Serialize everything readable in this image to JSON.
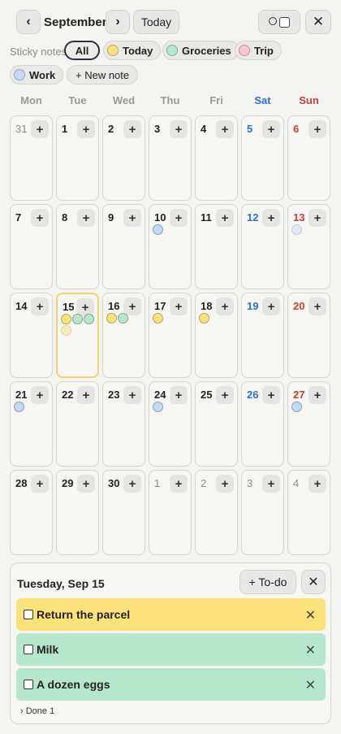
{
  "colors": {
    "today": "#fbe27b",
    "groceries": "#b6e7cd",
    "trip": "#f8c6d0",
    "work": "#c4d9f3",
    "saturday": "#2c6fd1",
    "sunday": "#c93c3c",
    "selected_border": "#f2d27a"
  },
  "header": {
    "month": "September",
    "prev_icon": "‹",
    "next_icon": "›",
    "today_label": "Today",
    "close_icon": "✕"
  },
  "filters": {
    "label": "Sticky notes",
    "all": "All",
    "today": "Today",
    "groceries": "Groceries",
    "trip": "Trip",
    "work": "Work",
    "new_note": "+ New note"
  },
  "weekdays": [
    "Mon",
    "Tue",
    "Wed",
    "Thu",
    "Fri",
    "Sat",
    "Sun"
  ],
  "calendar": {
    "add_icon": "+",
    "weeks": [
      [
        {
          "day": "31",
          "other": true,
          "notes": []
        },
        {
          "day": "1",
          "notes": []
        },
        {
          "day": "2",
          "notes": []
        },
        {
          "day": "3",
          "notes": []
        },
        {
          "day": "4",
          "notes": []
        },
        {
          "day": "5",
          "notes": []
        },
        {
          "day": "6",
          "notes": []
        }
      ],
      [
        {
          "day": "7",
          "notes": []
        },
        {
          "day": "8",
          "notes": []
        },
        {
          "day": "9",
          "notes": []
        },
        {
          "day": "10",
          "notes": [
            "work"
          ]
        },
        {
          "day": "11",
          "notes": []
        },
        {
          "day": "12",
          "notes": []
        },
        {
          "day": "13",
          "notes": [
            "work-faded"
          ]
        }
      ],
      [
        {
          "day": "14",
          "notes": []
        },
        {
          "day": "15",
          "selected": true,
          "notes": [
            "today",
            "groceries",
            "groceries",
            "today-faded"
          ]
        },
        {
          "day": "16",
          "notes": [
            "today",
            "groceries"
          ]
        },
        {
          "day": "17",
          "notes": [
            "today"
          ]
        },
        {
          "day": "18",
          "notes": [
            "today"
          ]
        },
        {
          "day": "19",
          "notes": []
        },
        {
          "day": "20",
          "notes": []
        }
      ],
      [
        {
          "day": "21",
          "notes": [
            "work"
          ]
        },
        {
          "day": "22",
          "notes": []
        },
        {
          "day": "23",
          "notes": []
        },
        {
          "day": "24",
          "notes": [
            "work"
          ]
        },
        {
          "day": "25",
          "notes": []
        },
        {
          "day": "26",
          "notes": []
        },
        {
          "day": "27",
          "notes": [
            "work"
          ]
        }
      ],
      [
        {
          "day": "28",
          "notes": []
        },
        {
          "day": "29",
          "notes": []
        },
        {
          "day": "30",
          "notes": []
        },
        {
          "day": "1",
          "other": true,
          "notes": []
        },
        {
          "day": "2",
          "other": true,
          "notes": []
        },
        {
          "day": "3",
          "other": true,
          "notes": []
        },
        {
          "day": "4",
          "other": true,
          "notes": []
        }
      ]
    ]
  },
  "panel": {
    "date": "Tuesday, Sep 15",
    "todo_button": "+ To-do",
    "close_icon": "✕",
    "items": [
      {
        "text": "Return the parcel",
        "category": "today"
      },
      {
        "text": "Milk",
        "category": "groceries"
      },
      {
        "text": "A dozen eggs",
        "category": "groceries"
      }
    ],
    "remove_icon": "✕",
    "done_label": "›  Done 1"
  }
}
